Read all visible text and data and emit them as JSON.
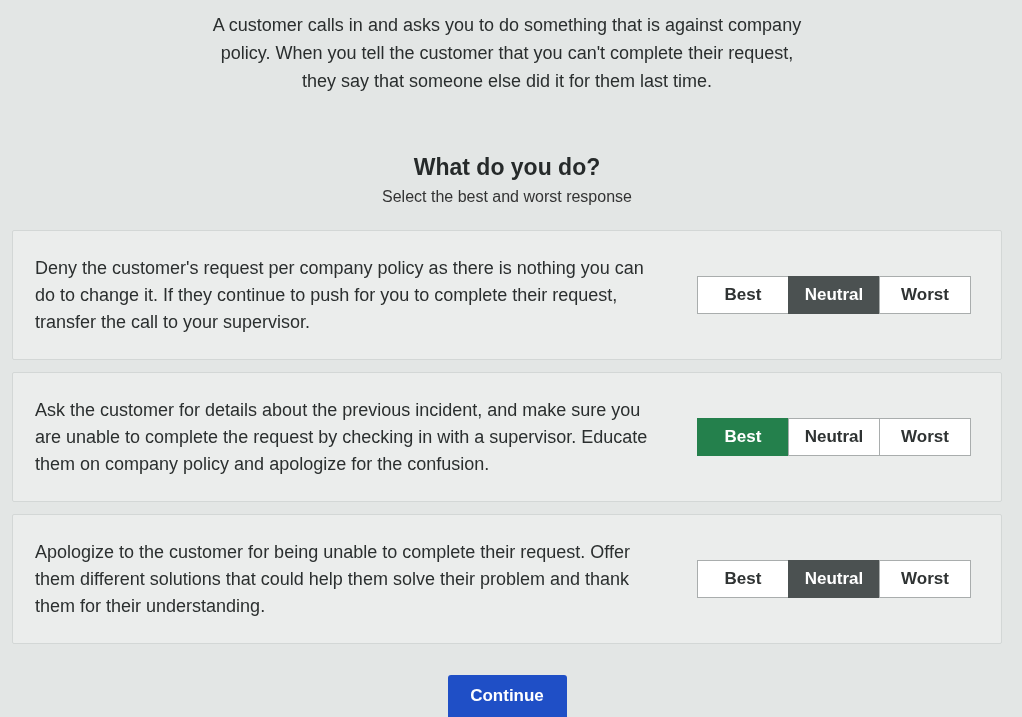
{
  "scenario": "A customer calls in and asks you to do something that is against company policy. When you tell the customer that you can't complete their request, they say that someone else did it for them last time.",
  "question": "What do you do?",
  "instruction": "Select the best and worst response",
  "responses": [
    {
      "text": "Deny the customer's request per company policy as there is nothing you can do to change it. If they continue to push for you to complete their request, transfer the call to your supervisor.",
      "options": [
        {
          "label": "Best",
          "selected": false
        },
        {
          "label": "Neutral",
          "selected": true
        },
        {
          "label": "Worst",
          "selected": false
        }
      ]
    },
    {
      "text": "Ask the customer for details about the previous incident, and make sure you are unable to complete the request by checking in with a supervisor. Educate them on company policy and apologize for the confusion.",
      "options": [
        {
          "label": "Best",
          "selected": true
        },
        {
          "label": "Neutral",
          "selected": false
        },
        {
          "label": "Worst",
          "selected": false
        }
      ]
    },
    {
      "text": "Apologize to the customer for being unable to complete their request. Offer them different solutions that could help them solve their problem and thank them for their understanding.",
      "options": [
        {
          "label": "Best",
          "selected": false
        },
        {
          "label": "Neutral",
          "selected": true
        },
        {
          "label": "Worst",
          "selected": false
        }
      ]
    }
  ],
  "continue_button": "Continue"
}
